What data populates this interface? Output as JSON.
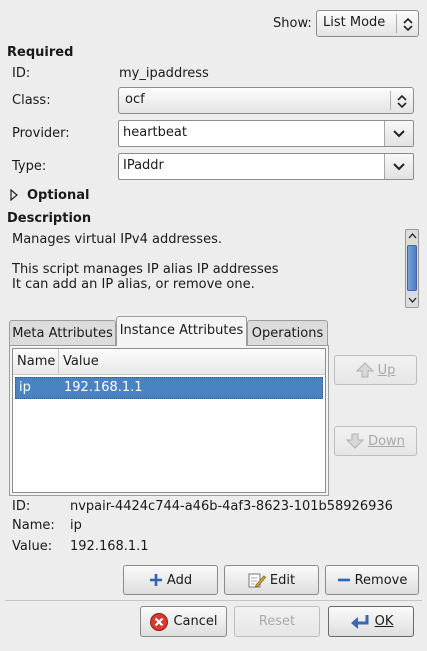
{
  "show": {
    "label": "Show:",
    "value": "List Mode"
  },
  "required": {
    "heading": "Required",
    "id_label": "ID:",
    "id_value": "my_ipaddress",
    "class_label": "Class:",
    "class_value": "ocf",
    "provider_label": "Provider:",
    "provider_value": "heartbeat",
    "type_label": "Type:",
    "type_value": "IPaddr"
  },
  "optional": {
    "label": "Optional"
  },
  "description": {
    "heading": "Description",
    "text": "Manages virtual IPv4 addresses.\n\nThis script manages IP alias IP addresses\nIt can add an IP alias, or remove one."
  },
  "tabs": [
    {
      "label": "Meta Attributes"
    },
    {
      "label": "Instance Attributes"
    },
    {
      "label": "Operations"
    }
  ],
  "table": {
    "columns": [
      "Name",
      "Value"
    ],
    "rows": [
      {
        "name": "ip",
        "value": "192.168.1.1"
      }
    ]
  },
  "side_buttons": {
    "up": "Up",
    "down": "Down"
  },
  "detail": {
    "id_label": "ID:",
    "id_value": "nvpair-4424c744-a46b-4af3-8623-101b58926936",
    "name_label": "Name:",
    "name_value": "ip",
    "value_label": "Value:",
    "value_value": "192.168.1.1"
  },
  "actions": {
    "add": "Add",
    "edit": "Edit",
    "remove": "Remove"
  },
  "footer": {
    "cancel": "Cancel",
    "reset": "Reset",
    "ok": "OK"
  }
}
